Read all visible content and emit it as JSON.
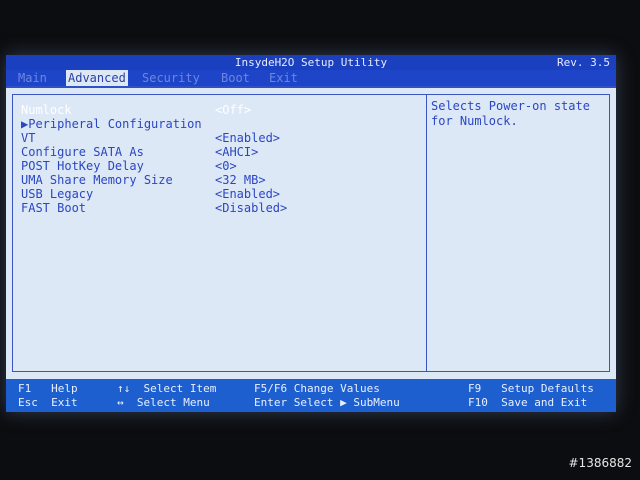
{
  "window": {
    "title": "InsydeH2O Setup Utility",
    "revision": "Rev. 3.5"
  },
  "menu": {
    "tabs": [
      {
        "label": "Main"
      },
      {
        "label": "Advanced"
      },
      {
        "label": "Security"
      },
      {
        "label": "Boot"
      },
      {
        "label": "Exit"
      }
    ],
    "active": "Advanced"
  },
  "settings": [
    {
      "label": "Numlock",
      "value": "<Off>"
    },
    {
      "label": "▶Peripheral Configuration",
      "value": ""
    },
    {
      "label": "VT",
      "value": "<Enabled>"
    },
    {
      "label": "Configure SATA As",
      "value": "<AHCI>"
    },
    {
      "label": "POST HotKey Delay",
      "value": "<0>"
    },
    {
      "label": "UMA Share Memory Size",
      "value": "<32 MB>"
    },
    {
      "label": "USB Legacy",
      "value": "<Enabled>"
    },
    {
      "label": "FAST Boot",
      "value": "<Disabled>"
    }
  ],
  "help": {
    "text": "Selects Power-on state for Numlock."
  },
  "footer": {
    "keys": [
      {
        "key": "F1",
        "action": "Help"
      },
      {
        "key": "Esc",
        "action": "Exit"
      },
      {
        "key": "↑↓",
        "action": "Select Item"
      },
      {
        "key": "↔",
        "action": "Select Menu"
      },
      {
        "key": "F5/F6",
        "action": "Change Values"
      },
      {
        "key": "Enter",
        "action": "Select ▶ SubMenu"
      },
      {
        "key": "F9",
        "action": "Setup Defaults"
      },
      {
        "key": "F10",
        "action": "Save and Exit"
      }
    ]
  },
  "watermark": "#1386882",
  "colors": {
    "title_bar": "#1a3fbf",
    "panel_bg": "#dde8f7",
    "text": "#2b46c2",
    "highlight": "#ffffff",
    "footer_bar": "#1e5fd0"
  }
}
